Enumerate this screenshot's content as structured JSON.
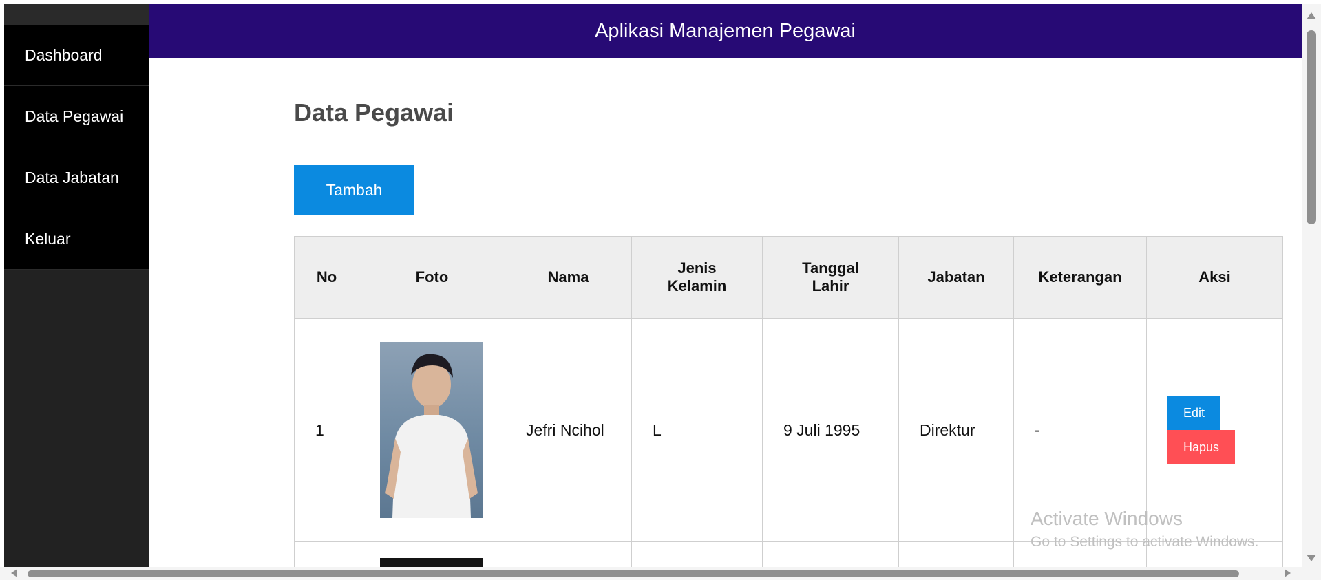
{
  "app": {
    "title": "Aplikasi Manajemen Pegawai"
  },
  "sidebar": {
    "items": [
      {
        "label": "Dashboard"
      },
      {
        "label": "Data Pegawai"
      },
      {
        "label": "Data Jabatan"
      },
      {
        "label": "Keluar"
      }
    ]
  },
  "main": {
    "page_title": "Data Pegawai",
    "add_button_label": "Tambah"
  },
  "table": {
    "headers": [
      "No",
      "Foto",
      "Nama",
      "Jenis Kelamin",
      "Tanggal Lahir",
      "Jabatan",
      "Keterangan",
      "Aksi"
    ],
    "rows": [
      {
        "no": "1",
        "nama": "Jefri Ncihol",
        "jenis_kelamin": "L",
        "tanggal_lahir": "9 Juli 1995",
        "jabatan": "Direktur",
        "keterangan": "-",
        "edit_label": "Edit",
        "hapus_label": "Hapus"
      }
    ]
  },
  "watermark": {
    "line1": "Activate Windows",
    "line2": "Go to Settings to activate Windows."
  },
  "colors": {
    "header_bg": "#270a75",
    "sidebar_bg": "#000000",
    "primary_button": "#0b8ae0",
    "danger_button": "#ff4f55"
  }
}
